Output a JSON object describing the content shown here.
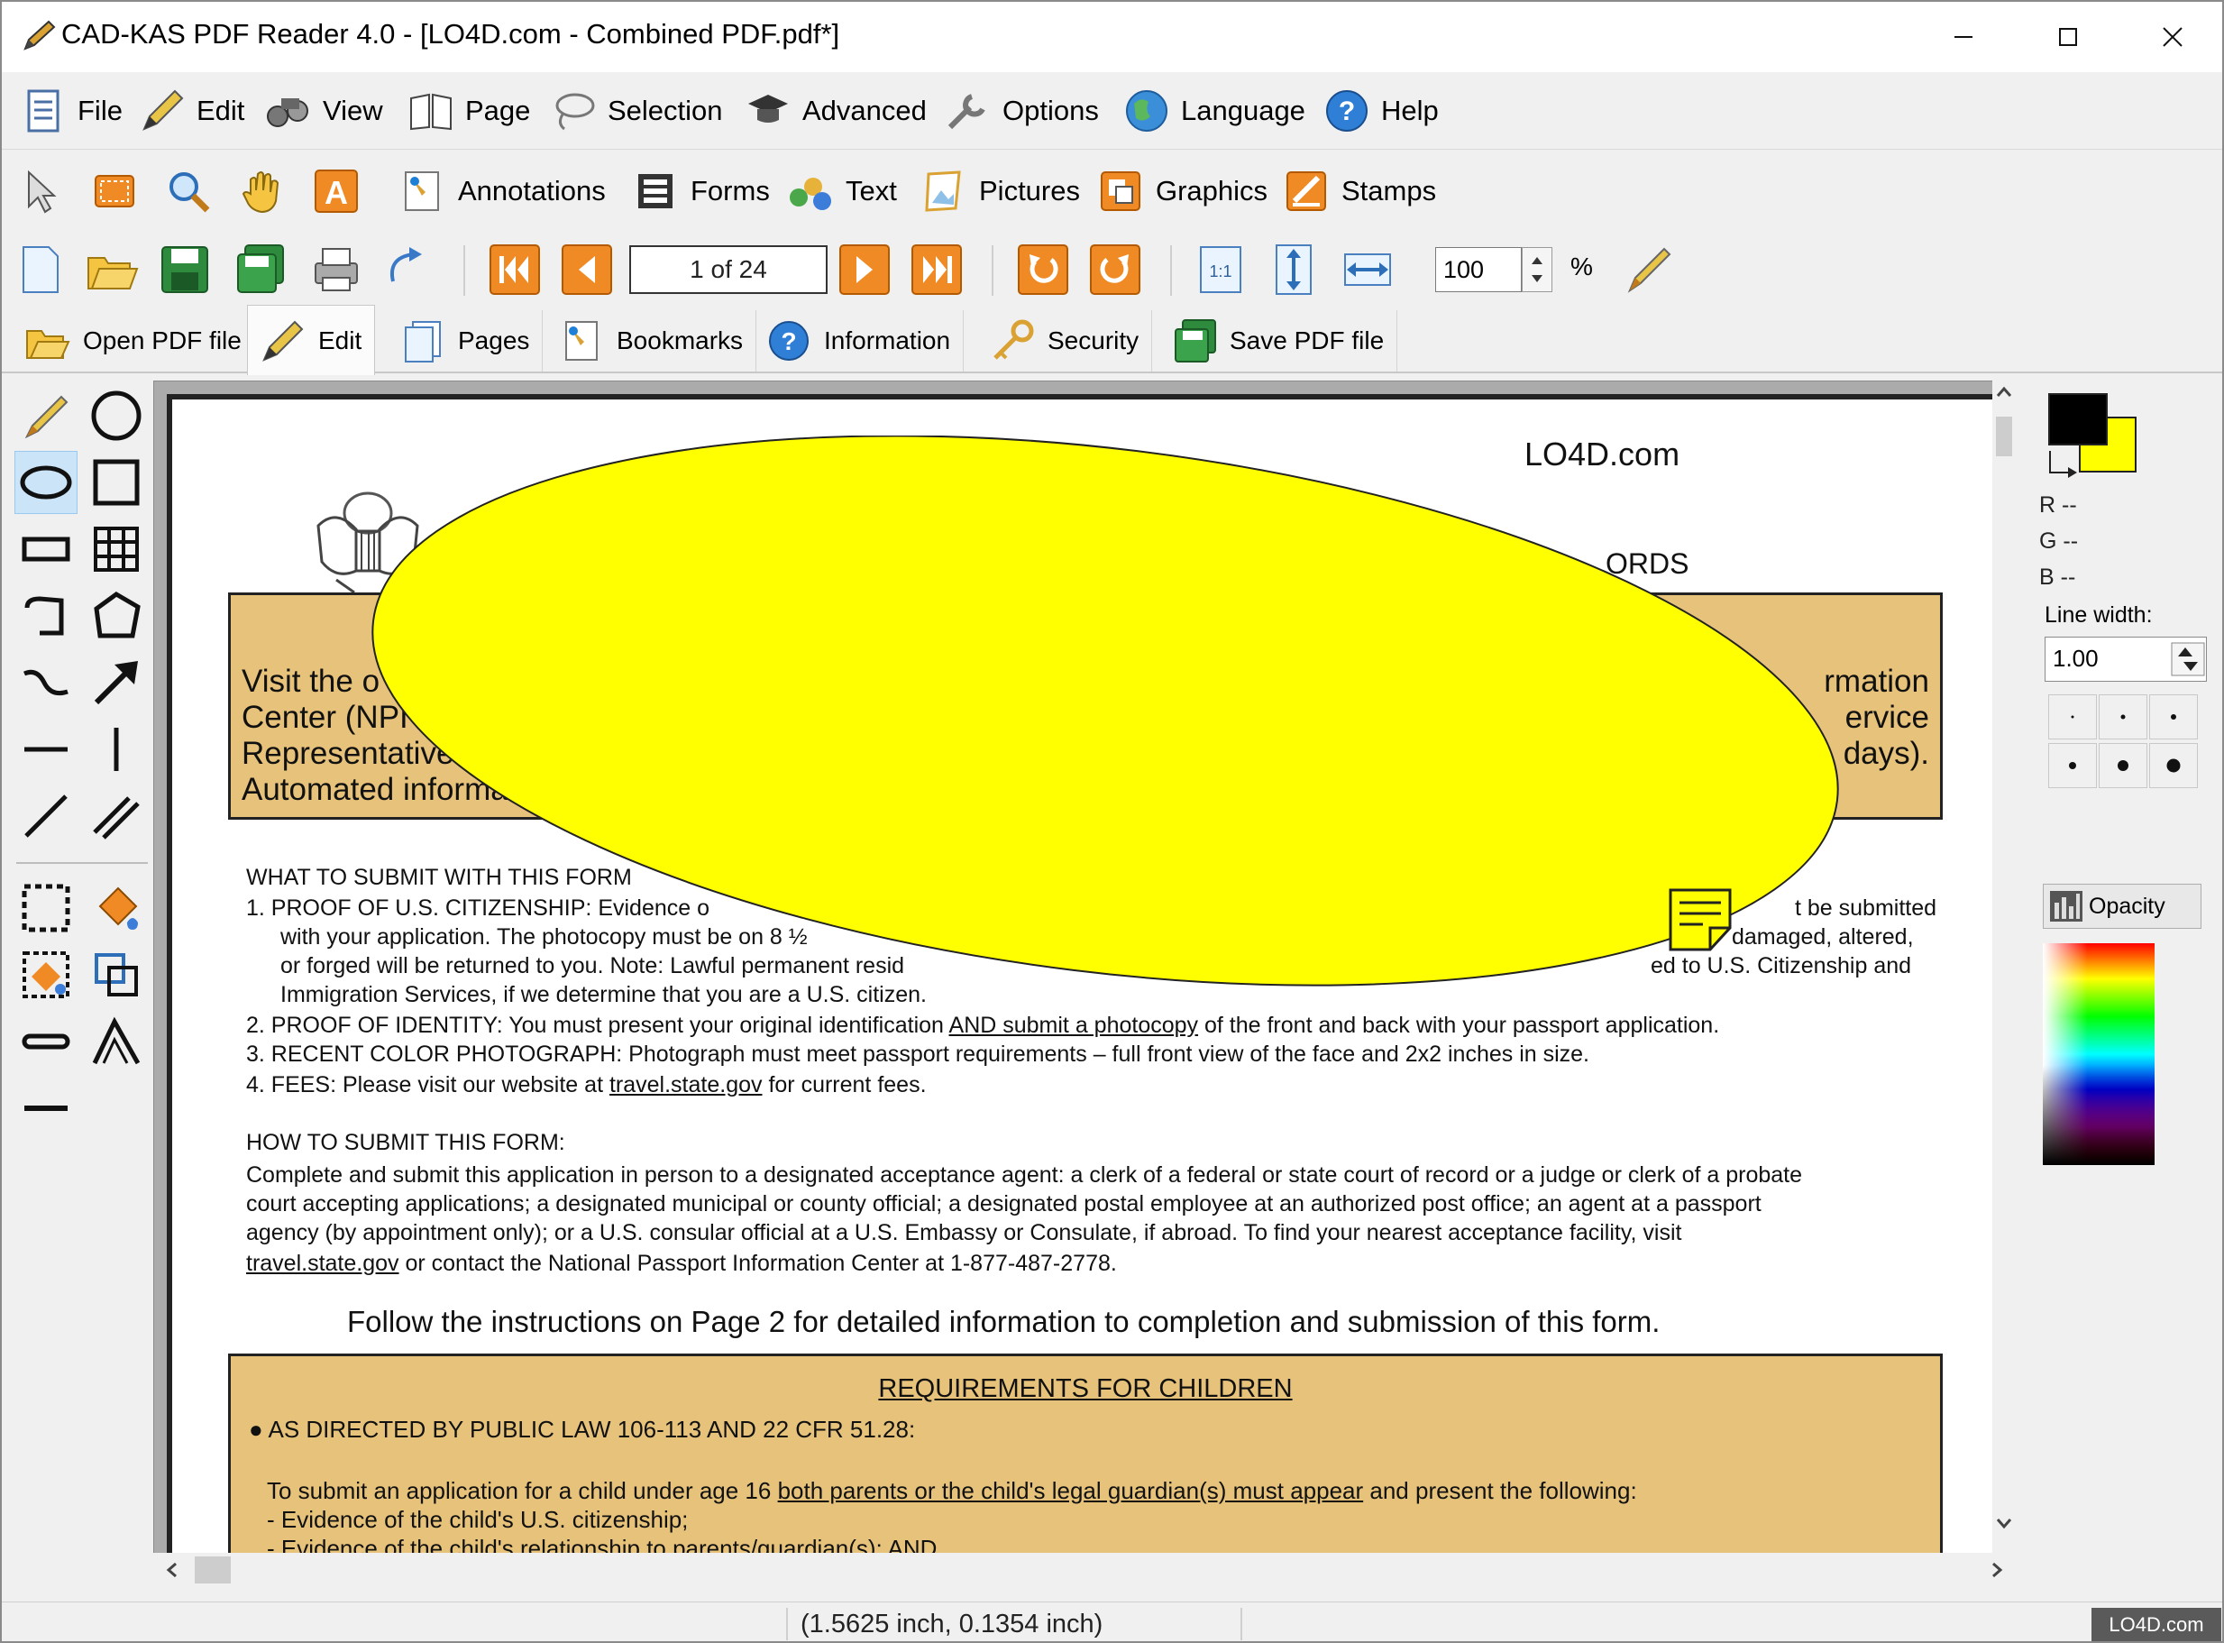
{
  "window": {
    "title": "CAD-KAS PDF Reader 4.0 - [LO4D.com - Combined PDF.pdf*]",
    "controls": {
      "minimize": "─",
      "maximize": "☐",
      "close": "✕"
    }
  },
  "menubar": {
    "items": [
      {
        "label": "File",
        "icon": "document-icon"
      },
      {
        "label": "Edit",
        "icon": "pencil-icon"
      },
      {
        "label": "View",
        "icon": "binoculars-icon"
      },
      {
        "label": "Page",
        "icon": "open-book-icon"
      },
      {
        "label": "Selection",
        "icon": "lasso-icon"
      },
      {
        "label": "Advanced",
        "icon": "graduation-cap-icon"
      },
      {
        "label": "Options",
        "icon": "wrench-icon"
      },
      {
        "label": "Language",
        "icon": "globe-icon"
      },
      {
        "label": "Help",
        "icon": "help-icon"
      }
    ]
  },
  "tools": {
    "labeled": [
      {
        "label": "Annotations",
        "icon": "annotation-pin-icon"
      },
      {
        "label": "Forms",
        "icon": "forms-icon"
      },
      {
        "label": "Text",
        "icon": "text-icon"
      },
      {
        "label": "Pictures",
        "icon": "pictures-icon"
      },
      {
        "label": "Graphics",
        "icon": "graphics-icon"
      },
      {
        "label": "Stamps",
        "icon": "stamp-icon"
      }
    ]
  },
  "navigation": {
    "page_indicator": "1 of 24",
    "zoom_value": "100",
    "zoom_unit": "%",
    "fit_label": "1:1"
  },
  "tabs": [
    {
      "label": "Open PDF file",
      "active": false
    },
    {
      "label": "Edit",
      "active": true
    },
    {
      "label": "Pages",
      "active": false
    },
    {
      "label": "Bookmarks",
      "active": false
    },
    {
      "label": "Information",
      "active": false
    },
    {
      "label": "Security",
      "active": false
    },
    {
      "label": "Save PDF file",
      "active": false
    }
  ],
  "right_panel": {
    "foreground_color": "#000000",
    "background_color": "#ffff00",
    "r_label": "R --",
    "g_label": "G --",
    "b_label": "B --",
    "line_width_label": "Line width:",
    "line_width_value": "1.00",
    "opacity_label": "Opacity"
  },
  "document": {
    "watermark_header": "LO4D.com",
    "records_fragment": "ORDS",
    "top_box": {
      "left_lines": [
        "Visit the o",
        "Center (NPI",
        "Representatives",
        "Automated informa"
      ],
      "right_lines": [
        "rmation",
        "ervice",
        "days)."
      ]
    },
    "what_to_submit": {
      "heading": "WHAT TO SUBMIT WITH THIS FORM",
      "item1_head": "1.  PROOF OF U.S. CITIZENSHIP: Evidence o",
      "item1_head_right": "t be submitted",
      "item1_line2_left": "with your application. The photocopy must be on 8 ½",
      "item1_line2_right": "damaged, altered,",
      "item1_line3_left": "or  forged  will  be  returned  to  you.  Note:  Lawful  permanent  resid",
      "item1_line3_right": "ed to U.S. Citizenship and",
      "item1_line4": "Immigration Services, if we determine that you are a U.S. citizen.",
      "item2_pre": "2.  PROOF OF IDENTITY: You must present your original identification ",
      "item2_link": "AND submit a photocopy",
      "item2_post": " of the front and back with your passport application.",
      "item3": "3.  RECENT COLOR PHOTOGRAPH: Photograph must meet passport requirements – full front view of the face and 2x2 inches in size.",
      "item4_pre": "4.  FEES: Please visit our website at ",
      "item4_link": "travel.state.gov",
      "item4_post": " for current fees."
    },
    "how_to_submit": {
      "heading": "HOW TO SUBMIT THIS FORM:",
      "line1": "Complete and submit this application in person to a designated acceptance agent:  a clerk of a federal or state court of record or a judge or clerk of a probate",
      "line2": "court accepting applications; a designated municipal or county official; a designated postal employee at an authorized post office; an agent at a passport",
      "line3": "agency  (by  appointment  only);  or  a  U.S.  consular  official  at  a  U.S.  Embassy  or  Consulate,  if  abroad.   To  find  your  nearest  acceptance  facility,  visit",
      "line4_link": "travel.state.gov",
      "line4_post": " or contact the National Passport Information Center at 1-877-487-2778."
    },
    "follow_instructions": "Follow the instructions on Page 2 for detailed information to completion and submission of this form.",
    "children_box": {
      "heading": "REQUIREMENTS FOR CHILDREN",
      "bullet": "AS DIRECTED BY PUBLIC LAW 106-113 AND 22 CFR 51.28:",
      "line1_pre": "To submit an application for a child under age 16 ",
      "line1_link": "both parents or the child's legal guardian(s) must appear",
      "line1_post": " and present the following:",
      "line2": "- Evidence of the child's U.S. citizenship;",
      "line3": "- Evidence of the child's relationship to parents/guardian(s); AND"
    },
    "ellipse_fill": "#ffff00"
  },
  "status": {
    "coordinates": "(1.5625 inch, 0.1354 inch)"
  },
  "watermark": {
    "text": "LO4D.com"
  }
}
